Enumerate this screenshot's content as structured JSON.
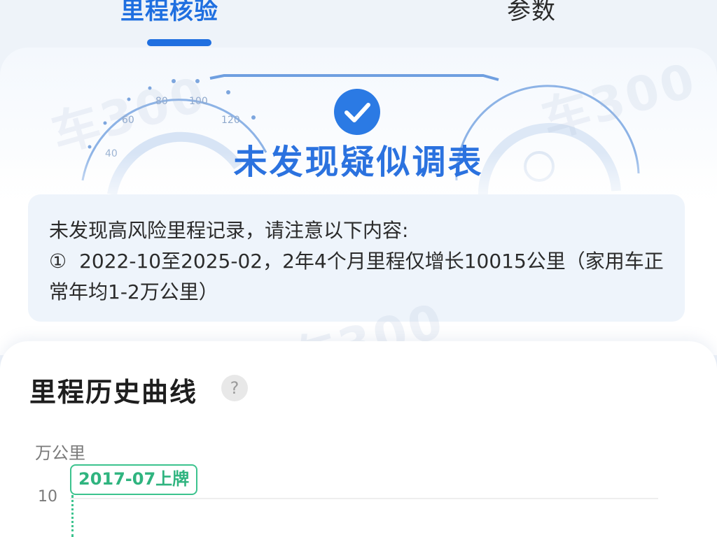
{
  "tabs": [
    {
      "label": "里程核验",
      "active": true
    },
    {
      "label": "参数",
      "active": false
    }
  ],
  "result": {
    "verdict": "未发现疑似调表",
    "icon": "check-circle-icon",
    "gauge_ticks": [
      "40",
      "60",
      "80",
      "100",
      "120"
    ],
    "watermark": "车300"
  },
  "notice": {
    "intro": "未发现高风险里程记录，请注意以下内容:",
    "items": [
      {
        "marker": "①",
        "text": "2022-10至2025-02，2年4个月里程仅增长10015公里（家用车正常年均1-2万公里）"
      }
    ]
  },
  "history": {
    "title": "里程历史曲线",
    "help_icon": "?",
    "unit": "万公里",
    "y_tick": "10",
    "registration_tag": "2017-07上牌"
  },
  "colors": {
    "accent": "#1f6fe0",
    "verdict": "#2b72df",
    "green": "#3cc38e"
  }
}
